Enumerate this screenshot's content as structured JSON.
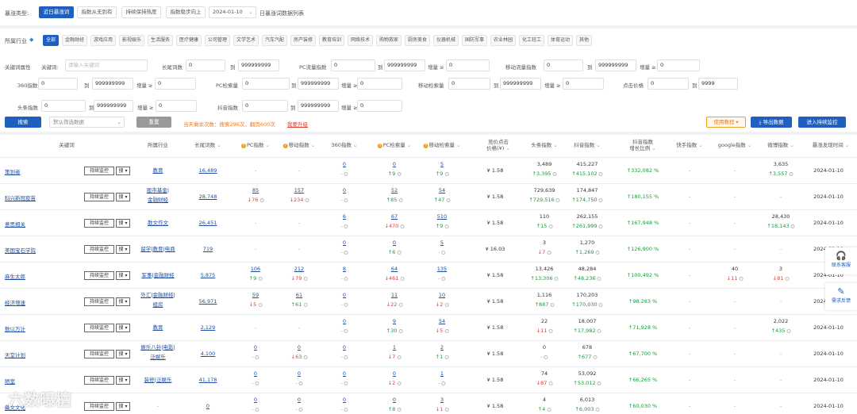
{
  "type_bar": {
    "label": "暴涨类型:",
    "tabs": [
      "近日暴涨词",
      "指数从无到有",
      "持续保持热度",
      "指数稳步向上"
    ],
    "date": "2024-01-10",
    "list_label": "日暴涨词数据列表"
  },
  "industry": {
    "label": "所属行业",
    "tags": [
      "全部",
      "金融财经",
      "游戏应用",
      "影视娱乐",
      "生活服务",
      "医疗健康",
      "公司管理",
      "文学艺术",
      "汽车汽配",
      "房产装修",
      "教育培训",
      "网络技术",
      "购物救家",
      "厨房美食",
      "仪器机械",
      "国防军事",
      "农业林园",
      "化工轻工",
      "体育运动",
      "其他"
    ]
  },
  "filters": {
    "attr_label": "关键词属性",
    "kw_label": "关键词:",
    "kw_placeholder": "请输入关键词",
    "to": "到",
    "ge": "增量 ≥",
    "changchang": "长尾词数",
    "pc_flow": "PC流量指数",
    "mobile_flow": "移动流量指数",
    "idx360": "360指数",
    "pc_check": "PC检索量",
    "mobile_check": "移动检索量",
    "click_price": "点击价格",
    "toutiao": "头条指数",
    "douyin": "抖音指数",
    "zero": "0",
    "max": "999999999",
    "max_price": "9999"
  },
  "actions": {
    "search": "搜索",
    "sort_placeholder": "默认筛选数据",
    "reset": "重置",
    "quota": "当天剩余次数：搜索296次，翻页600次",
    "upgrade": "我要升级",
    "tutorial": "使用教程",
    "export": "导出数据",
    "monitor": "进入持续监控"
  },
  "table": {
    "headers": {
      "kw": "关键词",
      "industry": "所属行业",
      "changchang": "长尾词数",
      "pc": "PC指数",
      "mobile": "移动指数",
      "i360": "360指数",
      "pcchk": "PC检索量",
      "mchk": "移动检索量",
      "price1": "竞价点击",
      "price2": "价格(¥)",
      "toutiao": "头条指数",
      "douyin": "抖音指数",
      "growth1": "抖音指数",
      "growth2": "增长比例",
      "kuaishou": "快手指数",
      "google": "google指数",
      "weibo": "微博指数",
      "date": "暴涨发现时间"
    },
    "btn_monitor": "持续监控",
    "btn_sou": "搜 ▾",
    "dash": "-",
    "rows": [
      {
        "kw": "策划者",
        "ind": [
          "教育"
        ],
        "cc": "16,489",
        "pc": [
          "-",
          ""
        ],
        "mo": [
          "-",
          ""
        ],
        "i360": [
          "0",
          "-"
        ],
        "pcc": [
          "0",
          "↑9"
        ],
        "mc": [
          "5",
          "↑9"
        ],
        "price": "¥ 1.58",
        "tt": [
          "3,489",
          "↑3,395"
        ],
        "dy": [
          "415,227",
          "↑415,102"
        ],
        "gr": "↑332,082 %",
        "ks": "-",
        "gg": "-",
        "wb": [
          "3,635",
          "↑3,557"
        ],
        "date": "2024-01-10"
      },
      {
        "kw": "科兴新冠疫苗",
        "ind": [
          "股市基金|",
          "金融财经"
        ],
        "cc": "28,748",
        "pc": [
          "85",
          "↓76"
        ],
        "mo": [
          "157",
          "↓234"
        ],
        "i360": [
          "0",
          "-"
        ],
        "pcc": [
          "52",
          "↑85"
        ],
        "mc": [
          "54",
          "↑47"
        ],
        "price": "¥ 1.58",
        "tt": [
          "729,639",
          "↑729,516"
        ],
        "dy": [
          "174,847",
          "↑174,750"
        ],
        "gr": "↑180,155 %",
        "ks": "-",
        "gg": "-",
        "wb": [
          "-",
          ""
        ],
        "date": "2024-01-10"
      },
      {
        "kw": "意思相关",
        "ind": [
          "散文作文"
        ],
        "cc": "26,451",
        "pc": [
          "-",
          ""
        ],
        "mo": [
          "-",
          ""
        ],
        "i360": [
          "6",
          "-"
        ],
        "pcc": [
          "67",
          "↓470"
        ],
        "mc": [
          "510",
          "↑9"
        ],
        "price": "¥ 1.58",
        "tt": [
          "110",
          "↑15"
        ],
        "dy": [
          "262,155",
          "↑261,999"
        ],
        "gr": "↑167,948 %",
        "ks": "-",
        "gg": "-",
        "wb": [
          "28,430",
          "↑18,143"
        ],
        "date": "2024-01-10"
      },
      {
        "kw": "美国宝石学院",
        "ind": [
          "留学|教育|电商"
        ],
        "cc": "719",
        "pc": [
          "-",
          ""
        ],
        "mo": [
          "-",
          ""
        ],
        "i360": [
          "0",
          "-"
        ],
        "pcc": [
          "0",
          "↑6"
        ],
        "mc": [
          "5",
          "-"
        ],
        "price": "¥ 16.03",
        "tt": [
          "3",
          "↓7"
        ],
        "dy": [
          "1,270",
          "↑1,269"
        ],
        "gr": "↑126,900 %",
        "ks": "-",
        "gg": "-",
        "wb": [
          "-",
          ""
        ],
        "date": "2024-01-10"
      },
      {
        "kw": "麻生太郎",
        "ind": [
          "军事|金融财经"
        ],
        "cc": "5,875",
        "pc": [
          "106",
          "↑9"
        ],
        "mo": [
          "212",
          "↓79"
        ],
        "i360": [
          "8",
          "-"
        ],
        "pcc": [
          "64",
          "↓461"
        ],
        "mc": [
          "135",
          "-"
        ],
        "price": "¥ 1.58",
        "tt": [
          "13,426",
          "↑13,306"
        ],
        "dy": [
          "48,284",
          "↑48,236"
        ],
        "gr": "↑100,492 %",
        "ks": "-",
        "gg": [
          "40",
          "↓11"
        ],
        "wb": [
          "3",
          "↓81"
        ],
        "date": "2024-01-10"
      },
      {
        "kw": "经济增速",
        "ind": [
          "外汇|金融财经|",
          "组房"
        ],
        "cc": "56,971",
        "pc": [
          "59",
          "↓5"
        ],
        "mo": [
          "61",
          "↑61"
        ],
        "i360": [
          "0",
          "-"
        ],
        "pcc": [
          "11",
          "↓22"
        ],
        "mc": [
          "10",
          "↓2"
        ],
        "price": "¥ 1.58",
        "tt": [
          "1,116",
          "↑887"
        ],
        "dy": [
          "170,203",
          "↑170,030"
        ],
        "gr": "↑98,283 %",
        "ks": "-",
        "gg": "-",
        "wb": [
          "-",
          ""
        ],
        "date": "2024-01-10"
      },
      {
        "kw": "数以万计",
        "ind": [
          "教育"
        ],
        "cc": "2,129",
        "pc": [
          "-",
          ""
        ],
        "mo": [
          "-",
          ""
        ],
        "i360": [
          "0",
          "-"
        ],
        "pcc": [
          "9",
          "↑30"
        ],
        "mc": [
          "54",
          "↓5"
        ],
        "price": "¥ 1.58",
        "tt": [
          "22",
          "↓11"
        ],
        "dy": [
          "18,007",
          "↑17,982"
        ],
        "gr": "↑71,928 %",
        "ks": "-",
        "gg": "-",
        "wb": [
          "2,022",
          "↑435"
        ],
        "date": "2024-01-10"
      },
      {
        "kw": "天堂计划",
        "ind": [
          "娱乐八卦|电影|",
          "泛娱乐"
        ],
        "cc": "4,100",
        "pc": [
          "0",
          "-"
        ],
        "mo": [
          "0",
          "↓63"
        ],
        "i360": [
          "0",
          "-"
        ],
        "pcc": [
          "1",
          "↓7"
        ],
        "mc": [
          "2",
          "↑1"
        ],
        "price": "¥ 1.58",
        "tt": [
          "0",
          "-"
        ],
        "dy": [
          "678",
          "↑677"
        ],
        "gr": "↑67,700 %",
        "ks": "-",
        "gg": "-",
        "wb": [
          "-",
          ""
        ],
        "date": "2024-01-10"
      },
      {
        "kw": "陋室",
        "ind": [
          "装修|泛娱乐"
        ],
        "cc": "41,178",
        "pc": [
          "0",
          "-"
        ],
        "mo": [
          "0",
          "-"
        ],
        "i360": [
          "0",
          "-"
        ],
        "pcc": [
          "0",
          "↓2"
        ],
        "mc": [
          "1",
          "-"
        ],
        "price": "¥ 1.58",
        "tt": [
          "74",
          "↓87"
        ],
        "dy": [
          "53,092",
          "↑53,012"
        ],
        "gr": "↑66,265 %",
        "ks": "-",
        "gg": "-",
        "wb": [
          "-",
          ""
        ],
        "date": "2024-01-10"
      },
      {
        "kw": "藏文文化",
        "ind": [
          "-"
        ],
        "cc": "0",
        "pc": [
          "0",
          "-"
        ],
        "mo": [
          "0",
          "-"
        ],
        "i360": [
          "0",
          "-"
        ],
        "pcc": [
          "0",
          "↑8"
        ],
        "mc": [
          "3",
          "↓1"
        ],
        "price": "¥ 1.58",
        "tt": [
          "4",
          "↑4"
        ],
        "dy": [
          "6,013",
          "↑6,003"
        ],
        "gr": "↑60,030 %",
        "ks": "-",
        "gg": "-",
        "wb": [
          "-",
          ""
        ],
        "date": "2024-01-10"
      }
    ]
  },
  "side": {
    "service": "联系客服",
    "feedback": "需求反馈"
  },
  "watermark": "六数曝檀"
}
